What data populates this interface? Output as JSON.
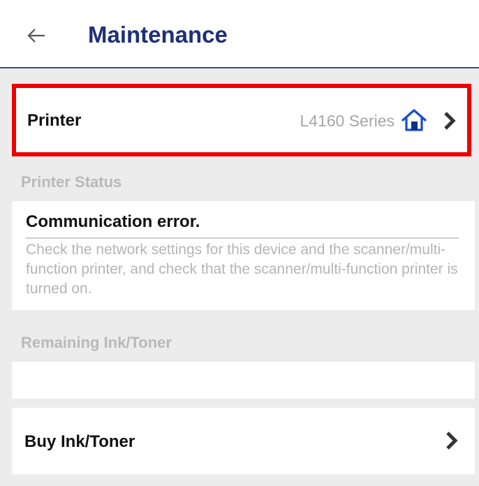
{
  "header": {
    "title": "Maintenance",
    "back_icon": "arrow-left-icon"
  },
  "printer": {
    "label": "Printer",
    "value": "L4160 Series",
    "home_icon": "home-icon",
    "chevron_icon": "chevron-right-icon",
    "highlight_color": "#ee0000"
  },
  "printer_status": {
    "section_label": "Printer Status",
    "title": "Communication error.",
    "message": "Check the network settings for this device and the scanner/multi-function printer, and check that the scanner/multi-function printer is turned on."
  },
  "ink": {
    "section_label": "Remaining Ink/Toner"
  },
  "buy": {
    "label": "Buy Ink/Toner",
    "chevron_icon": "chevron-right-icon"
  },
  "colors": {
    "accent": "#1f2f7a",
    "background": "#ececec",
    "muted_text": "#b5b5b5"
  }
}
